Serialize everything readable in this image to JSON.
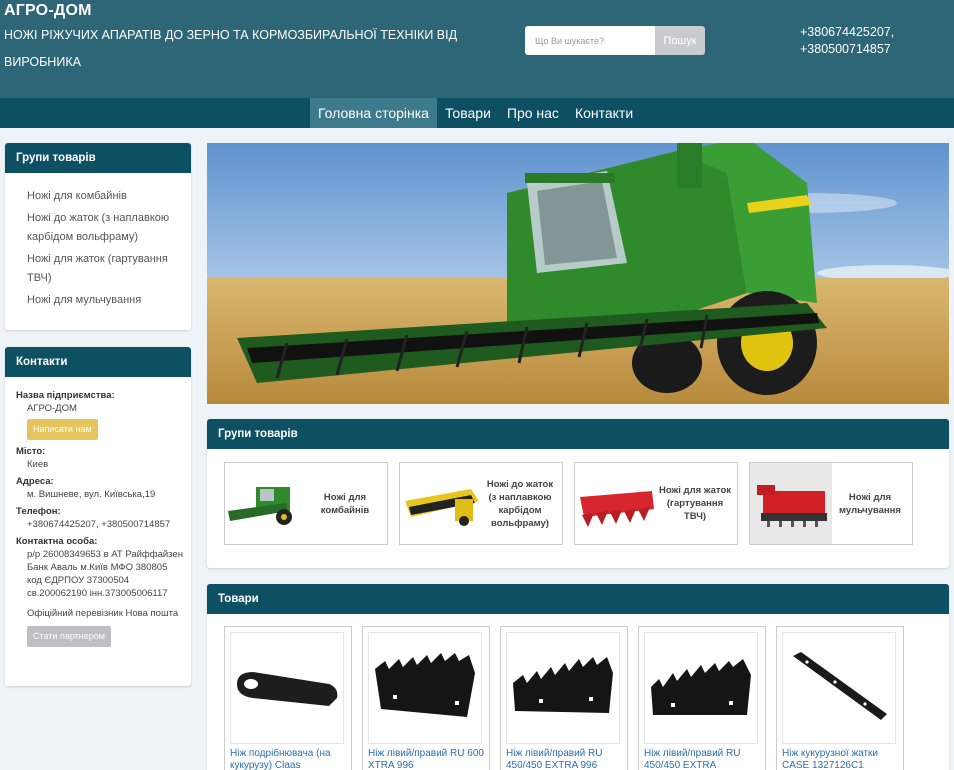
{
  "header": {
    "site_title": "АГРО-ДОМ",
    "site_desc": "НОЖІ РІЖУЧИХ АПАРАТІВ ДО ЗЕРНО ТА КОРМОЗБИРАЛЬНОЇ ТЕХНІКИ ВІД ВИРОБНИКА",
    "search_placeholder": "Що Ви шукаєте?",
    "search_button": "Пошук",
    "phone1": "+380674425207,",
    "phone2": "+380500714857"
  },
  "nav": {
    "items": [
      "Головна сторінка",
      "Товари",
      "Про нас",
      "Контакти"
    ]
  },
  "sidebar": {
    "groups_title": "Групи товарів",
    "groups": [
      "Ножі для комбайнів",
      "Ножі до жаток (з наплавкою карбідом вольфраму)",
      "Ножі для жаток (гартування ТВЧ)",
      "Ножі для мульчування"
    ],
    "contacts_title": "Контакти",
    "company_label": "Назва підприємства:",
    "company_value": "АГРО-ДОМ",
    "write_button": "Написати нам",
    "city_label": "Місто:",
    "city_value": "Киев",
    "address_label": "Адреса:",
    "address_value": "м. Вишневе, вул. Київська,19",
    "phone_label": "Телефон:",
    "phone_value": "+380674425207, +380500714857",
    "person_label": "Контактна особа:",
    "person_value": "р/р 26008349653 в АТ Райффайзен Банк Аваль м.Київ МФО 380805 код ЄДРПОУ 37300504 св.200062190 інн.373005006117",
    "carrier": "Офіційний перевізник Нова пошта",
    "partner_button": "Стати партнером"
  },
  "main": {
    "groups_title": "Групи товарів",
    "group_cards": [
      "Ножі для комбайнів",
      "Ножі до жаток (з наплавкою карбідом вольфраму)",
      "Ножі для жаток (гартування ТВЧ)",
      "Ножі для мульчування"
    ],
    "products_title": "Товари",
    "products": [
      "Ніж подрібнювача (на кукурузу) Claas",
      "Ніж лівий/правий RU 600 XTRA 996",
      "Ніж лівий/правий RU 450/450 EXTRA 996",
      "Ніж лівий/правий RU 450/450 EXTRA",
      "Ніж кукурузної жатки CASE 1327126C1"
    ]
  }
}
